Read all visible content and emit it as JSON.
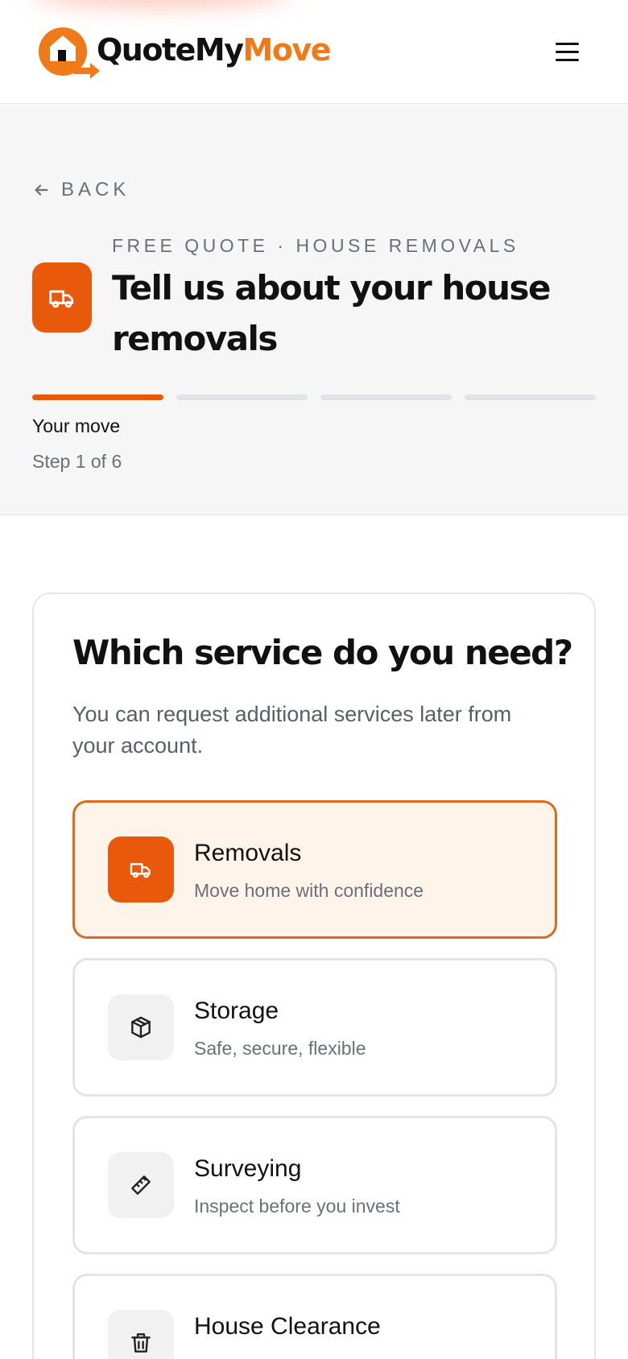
{
  "brand": {
    "name_part1": "QuoteMy",
    "name_part2": "Move",
    "accent": "#e8590c",
    "logo_orange": "#f07a1a"
  },
  "header": {
    "menu_icon": "hamburger-menu-icon"
  },
  "hero": {
    "back_label": "BACK",
    "eyebrow": "FREE QUOTE · HOUSE REMOVALS",
    "title": "Tell us about your house removals",
    "service_icon": "truck-icon",
    "progress": {
      "total_segments": 4,
      "active_segments": 1
    },
    "step_title": "Your move",
    "step_count": "Step 1 of 6"
  },
  "card": {
    "title": "Which service do you need?",
    "subtitle": "You can request additional services later from your account.",
    "options": [
      {
        "label": "Removals",
        "desc": "Move home with confidence",
        "icon": "truck-icon",
        "selected": true
      },
      {
        "label": "Storage",
        "desc": "Safe, secure, flexible",
        "icon": "box-icon",
        "selected": false
      },
      {
        "label": "Surveying",
        "desc": "Inspect before you invest",
        "icon": "ruler-icon",
        "selected": false
      },
      {
        "label": "House Clearance",
        "desc": "",
        "icon": "trash-icon",
        "selected": false
      }
    ]
  }
}
